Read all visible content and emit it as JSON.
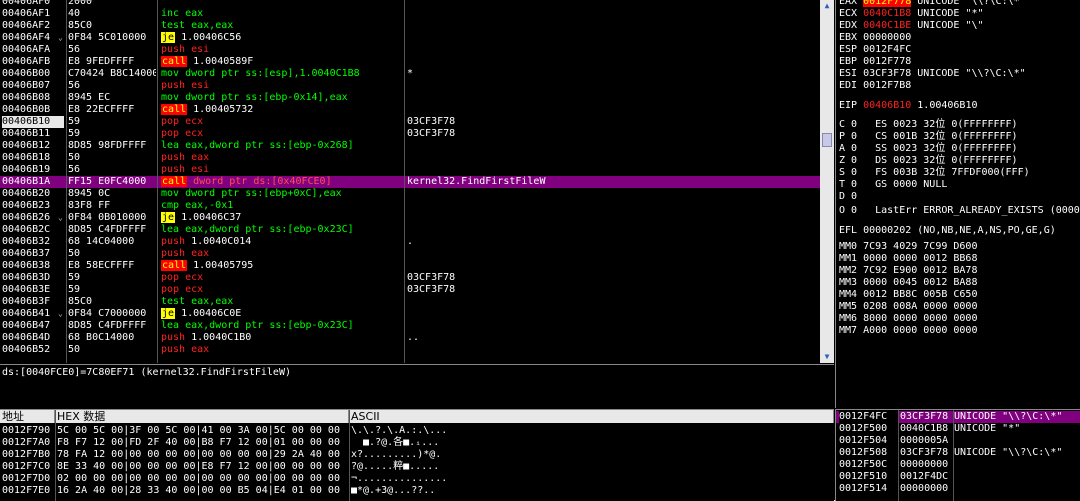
{
  "disasm": {
    "rows": [
      {
        "addr": "00406AF0",
        "jmp": "",
        "hex": "2000",
        "op": "",
        "args": "",
        "cmt": ""
      },
      {
        "addr": "00406AF1",
        "jmp": "",
        "hex": "40",
        "op": "inc",
        "args": "eax",
        "cmt": ""
      },
      {
        "addr": "00406AF2",
        "jmp": "",
        "hex": "85C0",
        "op": "test",
        "args": "eax,eax",
        "cmt": ""
      },
      {
        "addr": "00406AF4",
        "jmp": "⌄",
        "hex": "0F84 5C010000",
        "op": "je",
        "args": "1.00406C56",
        "cmt": ""
      },
      {
        "addr": "00406AFA",
        "jmp": "",
        "hex": "56",
        "op": "push",
        "args": "esi",
        "cmt": ""
      },
      {
        "addr": "00406AFB",
        "jmp": "",
        "hex": "E8 9FEDFFFF",
        "op": "call",
        "args": "1.0040589F",
        "cmt": ""
      },
      {
        "addr": "00406B00",
        "jmp": "",
        "hex": "C70424 B8C14000",
        "op": "mov",
        "args": "dword ptr ss:[esp],1.0040C1B8",
        "cmt": "*"
      },
      {
        "addr": "00406B07",
        "jmp": "",
        "hex": "56",
        "op": "push",
        "args": "esi",
        "cmt": ""
      },
      {
        "addr": "00406B08",
        "jmp": "",
        "hex": "8945 EC",
        "op": "mov",
        "args": "dword ptr ss:[ebp-0x14],eax",
        "cmt": ""
      },
      {
        "addr": "00406B0B",
        "jmp": "",
        "hex": "E8 22ECFFFF",
        "op": "call",
        "args": "1.00405732",
        "cmt": ""
      },
      {
        "addr": "00406B10",
        "jmp": "",
        "hex": "59",
        "op": "pop",
        "args": "ecx",
        "cmt": "03CF3F78"
      },
      {
        "addr": "00406B11",
        "jmp": "",
        "hex": "59",
        "op": "pop",
        "args": "ecx",
        "cmt": "03CF3F78"
      },
      {
        "addr": "00406B12",
        "jmp": "",
        "hex": "8D85 98FDFFFF",
        "op": "lea",
        "args": "eax,dword ptr ss:[ebp-0x268]",
        "cmt": ""
      },
      {
        "addr": "00406B18",
        "jmp": "",
        "hex": "50",
        "op": "push",
        "args": "eax",
        "cmt": ""
      },
      {
        "addr": "00406B19",
        "jmp": "",
        "hex": "56",
        "op": "push",
        "args": "esi",
        "cmt": ""
      },
      {
        "addr": "00406B1A",
        "jmp": "",
        "hex": "FF15 E0FC4000",
        "op": "call",
        "args": "dword ptr ds:[0x40FCE0]",
        "cmt": "kernel32.FindFirstFileW"
      },
      {
        "addr": "00406B20",
        "jmp": "",
        "hex": "8945 0C",
        "op": "mov",
        "args": "dword ptr ss:[ebp+0xC],eax",
        "cmt": ""
      },
      {
        "addr": "00406B23",
        "jmp": "",
        "hex": "83F8 FF",
        "op": "cmp",
        "args": "eax,-0x1",
        "cmt": ""
      },
      {
        "addr": "00406B26",
        "jmp": "⌄",
        "hex": "0F84 0B010000",
        "op": "je",
        "args": "1.00406C37",
        "cmt": ""
      },
      {
        "addr": "00406B2C",
        "jmp": "",
        "hex": "8D85 C4FDFFFF",
        "op": "lea",
        "args": "eax,dword ptr ss:[ebp-0x23C]",
        "cmt": ""
      },
      {
        "addr": "00406B32",
        "jmp": "",
        "hex": "68 14C04000",
        "op": "push",
        "args": "1.0040C014",
        "cmt": "."
      },
      {
        "addr": "00406B37",
        "jmp": "",
        "hex": "50",
        "op": "push",
        "args": "eax",
        "cmt": ""
      },
      {
        "addr": "00406B38",
        "jmp": "",
        "hex": "E8 58ECFFFF",
        "op": "call",
        "args": "1.00405795",
        "cmt": ""
      },
      {
        "addr": "00406B3D",
        "jmp": "",
        "hex": "59",
        "op": "pop",
        "args": "ecx",
        "cmt": "03CF3F78"
      },
      {
        "addr": "00406B3E",
        "jmp": "",
        "hex": "59",
        "op": "pop",
        "args": "ecx",
        "cmt": "03CF3F78"
      },
      {
        "addr": "00406B3F",
        "jmp": "",
        "hex": "85C0",
        "op": "test",
        "args": "eax,eax",
        "cmt": ""
      },
      {
        "addr": "00406B41",
        "jmp": "⌄",
        "hex": "0F84 C7000000",
        "op": "je",
        "args": "1.00406C0E",
        "cmt": ""
      },
      {
        "addr": "00406B47",
        "jmp": "",
        "hex": "8D85 C4FDFFFF",
        "op": "lea",
        "args": "eax,dword ptr ss:[ebp-0x23C]",
        "cmt": ""
      },
      {
        "addr": "00406B4D",
        "jmp": "",
        "hex": "68 B0C14000",
        "op": "push",
        "args": "1.0040C1B0",
        "cmt": ".."
      },
      {
        "addr": "00406B52",
        "jmp": "",
        "hex": "50",
        "op": "push",
        "args": "eax",
        "cmt": ""
      }
    ]
  },
  "info_line": "ds:[0040FCE0]=7C80EF71 (kernel32.FindFirstFileW)",
  "registers": {
    "lines": [
      {
        "t": "EAX ",
        "hl": "0012F778",
        "rest": " UNICODE \"\\\\?\\C:\\*\"",
        "red": false
      },
      {
        "t": "ECX ",
        "red_val": "0040C1B8",
        "rest": " UNICODE \"*\""
      },
      {
        "t": "EDX ",
        "red_val": "0040C1BE",
        "rest": " UNICODE \"\\\""
      },
      {
        "t": "EBX 00000000",
        "rest": ""
      },
      {
        "t": "ESP 0012F4FC",
        "rest": ""
      },
      {
        "t": "EBP 0012F778",
        "rest": ""
      },
      {
        "t": "ESI 03CF3F78",
        "rest": " UNICODE \"\\\\?\\C:\\*\""
      },
      {
        "t": "EDI 0012F7B8",
        "rest": ""
      },
      {
        "t": "",
        "rest": ""
      },
      {
        "t": "EIP ",
        "red_val": "00406B10",
        "rest": " 1.00406B10"
      },
      {
        "t": "",
        "rest": ""
      },
      {
        "t": "C 0   ES 0023 32位 0(FFFFFFFF)",
        "rest": ""
      },
      {
        "t": "P 0   CS 001B 32位 0(FFFFFFFF)",
        "rest": ""
      },
      {
        "t": "A 0   SS 0023 32位 0(FFFFFFFF)",
        "rest": ""
      },
      {
        "t": "Z 0   DS 0023 32位 0(FFFFFFFF)",
        "rest": ""
      },
      {
        "t": "S 0   FS 003B 32位 7FFDF000(FFF)",
        "rest": ""
      },
      {
        "t": "T 0   GS 0000 NULL",
        "rest": ""
      },
      {
        "t": "D 0",
        "rest": ""
      },
      {
        "t": "O 0   LastErr ERROR_ALREADY_EXISTS (00000",
        "rest": ""
      },
      {
        "t": "",
        "rest": ""
      },
      {
        "t": "EFL 00000202 (NO,NB,NE,A,NS,PO,GE,G)",
        "rest": ""
      },
      {
        "t": "",
        "rest": ""
      },
      {
        "t": "MM0 7C93 4029 7C99 D600",
        "rest": ""
      },
      {
        "t": "MM1 0000 0000 0012 BB68",
        "rest": ""
      },
      {
        "t": "MM2 7C92 E900 0012 BA78",
        "rest": ""
      },
      {
        "t": "MM3 0000 0045 0012 BA88",
        "rest": ""
      },
      {
        "t": "MM4 0012 BB8C 005B C650",
        "rest": ""
      },
      {
        "t": "MM5 0208 008A 0000 0000",
        "rest": ""
      },
      {
        "t": "MM6 8000 0000 0000 0000",
        "rest": ""
      },
      {
        "t": "MM7 A000 0000 0000 0000",
        "rest": ""
      }
    ]
  },
  "dump": {
    "headers": {
      "addr": "地址",
      "hex": "HEX 数据",
      "ascii": "ASCII"
    },
    "rows": [
      {
        "a": "0012F790",
        "h": "5C 00 5C 00|3F 00 5C 00|41 00 3A 00|5C 00 00 00",
        "s": "\\.\\.?.\\.A.:.\\..."
      },
      {
        "a": "0012F7A0",
        "h": "F8 F7 12 00|FD 2F 40 00|B8 F7 12 00|01 00 00 00",
        "s": "  ■.?@.各■.ᵢ..."
      },
      {
        "a": "0012F7B0",
        "h": "78 FA 12 00|00 00 00 00|00 00 00 00|29 2A 40 00",
        "s": "x?.........)*@."
      },
      {
        "a": "0012F7C0",
        "h": "8E 33 40 00|00 00 00 00|E8 F7 12 00|00 00 00 00",
        "s": "?@.....粹■....."
      },
      {
        "a": "0012F7D0",
        "h": "02 00 00 00|00 00 00 00|00 00 00 00|00 00 00 00",
        "s": "¬..............."
      },
      {
        "a": "0012F7E0",
        "h": "16 2A 40 00|28 33 40 00|00 00 B5 04|E4 01 00 00",
        "s": "■*@.+3@...??.."
      }
    ]
  },
  "stack": {
    "rows": [
      {
        "a": "0012F4FC",
        "v": "03CF3F78",
        "c": "UNICODE \"\\\\?\\C:\\*\"",
        "top": true
      },
      {
        "a": "0012F500",
        "v": "0040C1B8",
        "c": "UNICODE \"*\"",
        "top": false
      },
      {
        "a": "0012F504",
        "v": "0000005A",
        "c": "",
        "top": false
      },
      {
        "a": "0012F508",
        "v": "03CF3F78",
        "c": "UNICODE \"\\\\?\\C:\\*\"",
        "top": false
      },
      {
        "a": "0012F50C",
        "v": "00000000",
        "c": "",
        "top": false
      },
      {
        "a": "0012F510",
        "v": "0012F4DC",
        "c": "",
        "top": false
      },
      {
        "a": "0012F514",
        "v": "00000000",
        "c": "",
        "top": false
      }
    ]
  }
}
